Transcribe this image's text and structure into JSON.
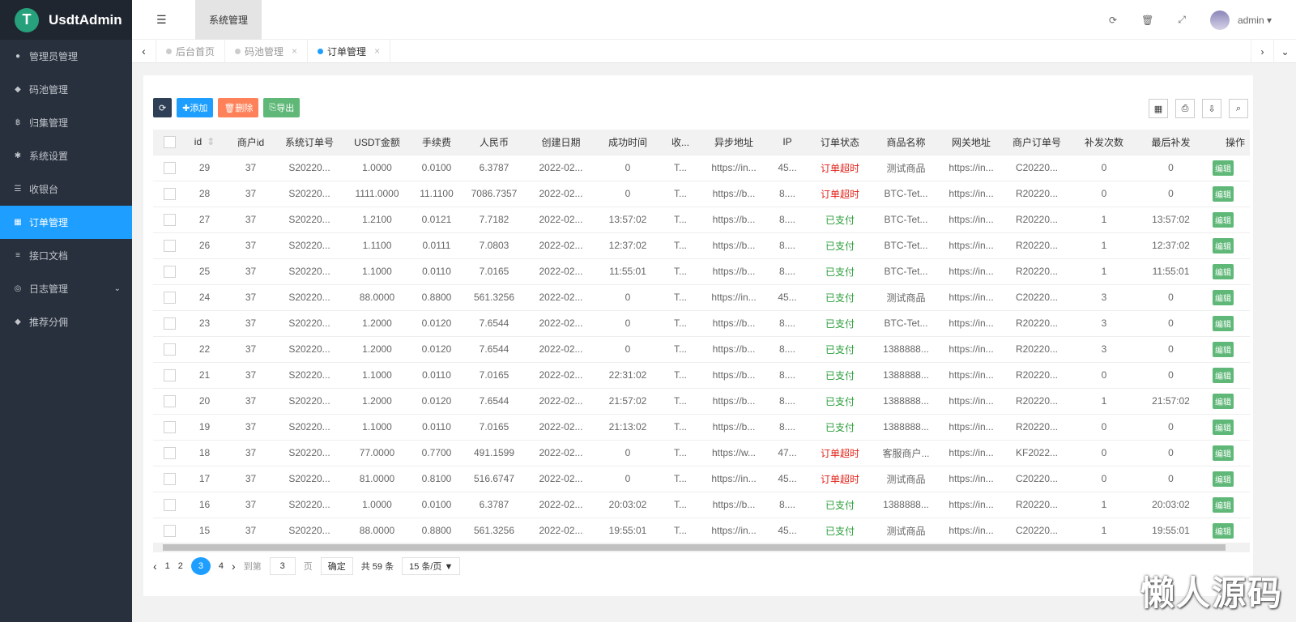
{
  "app": {
    "title": "UsdtAdmin",
    "logo_glyph": "T"
  },
  "sidebar": {
    "items": [
      {
        "label": "管理员管理",
        "icon": "user-icon",
        "glyph": "●"
      },
      {
        "label": "码池管理",
        "icon": "android-icon",
        "glyph": "◆"
      },
      {
        "label": "归集管理",
        "icon": "bitcoin-icon",
        "glyph": "฿"
      },
      {
        "label": "系统设置",
        "icon": "asterisk-icon",
        "glyph": "✱"
      },
      {
        "label": "收银台",
        "icon": "list-icon",
        "glyph": "☰"
      },
      {
        "label": "订单管理",
        "icon": "calculator-icon",
        "glyph": "▦",
        "active": true
      },
      {
        "label": "接口文档",
        "icon": "align-icon",
        "glyph": "≡"
      },
      {
        "label": "日志管理",
        "icon": "globe-icon",
        "glyph": "◎",
        "has_children": true
      },
      {
        "label": "推荐分佣",
        "icon": "android-icon",
        "glyph": "◆"
      }
    ]
  },
  "header": {
    "menu_glyph": "☰",
    "section": "系统管理",
    "user": "admin ▾"
  },
  "tabs": [
    {
      "label": "后台首页"
    },
    {
      "label": "码池管理"
    },
    {
      "label": "订单管理",
      "active": true
    }
  ],
  "toolbar": {
    "add": "添加",
    "delete": "删除",
    "export": "导出"
  },
  "table": {
    "columns": [
      "id",
      "商户id",
      "系统订单号",
      "USDT金额",
      "手续费",
      "人民币",
      "创建日期",
      "成功时间",
      "收...",
      "异步地址",
      "IP",
      "订单状态",
      "商品名称",
      "网关地址",
      "商户订单号",
      "补发次数",
      "最后补发",
      "操作"
    ],
    "edit_label": "编辑",
    "rows": [
      [
        "29",
        "37",
        "S20220...",
        "1.0000",
        "0.0100",
        "6.3787",
        "2022-02...",
        "0",
        "T...",
        "https://in...",
        "45...",
        "订单超时",
        "测试商品",
        "https://in...",
        "C20220...",
        "0",
        "0"
      ],
      [
        "28",
        "37",
        "S20220...",
        "1111.0000",
        "11.1100",
        "7086.7357",
        "2022-02...",
        "0",
        "T...",
        "https://b...",
        "8....",
        "订单超时",
        "BTC-Tet...",
        "https://in...",
        "R20220...",
        "0",
        "0"
      ],
      [
        "27",
        "37",
        "S20220...",
        "1.2100",
        "0.0121",
        "7.7182",
        "2022-02...",
        "13:57:02",
        "T...",
        "https://b...",
        "8....",
        "已支付",
        "BTC-Tet...",
        "https://in...",
        "R20220...",
        "1",
        "13:57:02"
      ],
      [
        "26",
        "37",
        "S20220...",
        "1.1100",
        "0.0111",
        "7.0803",
        "2022-02...",
        "12:37:02",
        "T...",
        "https://b...",
        "8....",
        "已支付",
        "BTC-Tet...",
        "https://in...",
        "R20220...",
        "1",
        "12:37:02"
      ],
      [
        "25",
        "37",
        "S20220...",
        "1.1000",
        "0.0110",
        "7.0165",
        "2022-02...",
        "11:55:01",
        "T...",
        "https://b...",
        "8....",
        "已支付",
        "BTC-Tet...",
        "https://in...",
        "R20220...",
        "1",
        "11:55:01"
      ],
      [
        "24",
        "37",
        "S20220...",
        "88.0000",
        "0.8800",
        "561.3256",
        "2022-02...",
        "0",
        "T...",
        "https://in...",
        "45...",
        "已支付",
        "测试商品",
        "https://in...",
        "C20220...",
        "3",
        "0"
      ],
      [
        "23",
        "37",
        "S20220...",
        "1.2000",
        "0.0120",
        "7.6544",
        "2022-02...",
        "0",
        "T...",
        "https://b...",
        "8....",
        "已支付",
        "BTC-Tet...",
        "https://in...",
        "R20220...",
        "3",
        "0"
      ],
      [
        "22",
        "37",
        "S20220...",
        "1.2000",
        "0.0120",
        "7.6544",
        "2022-02...",
        "0",
        "T...",
        "https://b...",
        "8....",
        "已支付",
        "1388888...",
        "https://in...",
        "R20220...",
        "3",
        "0"
      ],
      [
        "21",
        "37",
        "S20220...",
        "1.1000",
        "0.0110",
        "7.0165",
        "2022-02...",
        "22:31:02",
        "T...",
        "https://b...",
        "8....",
        "已支付",
        "1388888...",
        "https://in...",
        "R20220...",
        "0",
        "0"
      ],
      [
        "20",
        "37",
        "S20220...",
        "1.2000",
        "0.0120",
        "7.6544",
        "2022-02...",
        "21:57:02",
        "T...",
        "https://b...",
        "8....",
        "已支付",
        "1388888...",
        "https://in...",
        "R20220...",
        "1",
        "21:57:02"
      ],
      [
        "19",
        "37",
        "S20220...",
        "1.1000",
        "0.0110",
        "7.0165",
        "2022-02...",
        "21:13:02",
        "T...",
        "https://b...",
        "8....",
        "已支付",
        "1388888...",
        "https://in...",
        "R20220...",
        "0",
        "0"
      ],
      [
        "18",
        "37",
        "S20220...",
        "77.0000",
        "0.7700",
        "491.1599",
        "2022-02...",
        "0",
        "T...",
        "https://w...",
        "47...",
        "订单超时",
        "客服商户...",
        "https://in...",
        "KF2022...",
        "0",
        "0"
      ],
      [
        "17",
        "37",
        "S20220...",
        "81.0000",
        "0.8100",
        "516.6747",
        "2022-02...",
        "0",
        "T...",
        "https://in...",
        "45...",
        "订单超时",
        "测试商品",
        "https://in...",
        "C20220...",
        "0",
        "0"
      ],
      [
        "16",
        "37",
        "S20220...",
        "1.0000",
        "0.0100",
        "6.3787",
        "2022-02...",
        "20:03:02",
        "T...",
        "https://b...",
        "8....",
        "已支付",
        "1388888...",
        "https://in...",
        "R20220...",
        "1",
        "20:03:02"
      ],
      [
        "15",
        "37",
        "S20220...",
        "88.0000",
        "0.8800",
        "561.3256",
        "2022-02...",
        "19:55:01",
        "T...",
        "https://in...",
        "45...",
        "已支付",
        "测试商品",
        "https://in...",
        "C20220...",
        "1",
        "19:55:01"
      ]
    ]
  },
  "pagination": {
    "pages": [
      "1",
      "2",
      "3",
      "4"
    ],
    "current": "3",
    "goto_label": "到第",
    "goto_value": "3",
    "page_unit": "页",
    "confirm": "确定",
    "total": "共 59 条",
    "page_size": "15 条/页 ▼"
  },
  "colors": {
    "sidebar": "#28303d",
    "active": "#1e9fff",
    "timeout": "#e2231a",
    "paid": "#2a9d3a"
  },
  "watermark": "懒人源码"
}
